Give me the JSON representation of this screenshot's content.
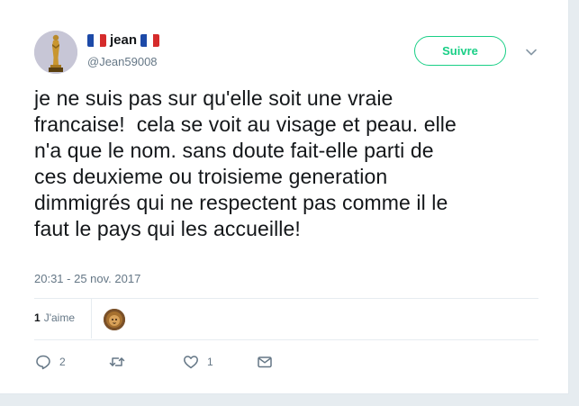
{
  "tweet": {
    "display_name": "jean",
    "handle": "@Jean59008",
    "follow_label": "Suivre",
    "text": "je ne suis pas sur qu'elle soit une vraie\nfrancaise!  cela se voit au visage et peau. elle\nn'a que le nom. sans doute fait-elle parti de\nces deuxieme ou troisieme generation\ndimmigrés qui ne respectent pas comme il le\nfaut le pays qui les accueille!",
    "timestamp": "20:31 - 25 nov. 2017",
    "likes_count": "1",
    "likes_label": "J'aime"
  },
  "actions": {
    "reply_count": "2",
    "retweet_count": "",
    "like_count": "1"
  },
  "icons": {
    "avatar": "oscar-statue-avatar",
    "flag": "france-flag-icon",
    "caret": "chevron-down-icon",
    "reply": "reply-icon",
    "retweet": "retweet-icon",
    "like": "heart-icon",
    "dm": "envelope-icon"
  },
  "colors": {
    "follow": "#19cf86",
    "text": "#14171a",
    "muted": "#657786",
    "background": "#e6ecf0"
  }
}
